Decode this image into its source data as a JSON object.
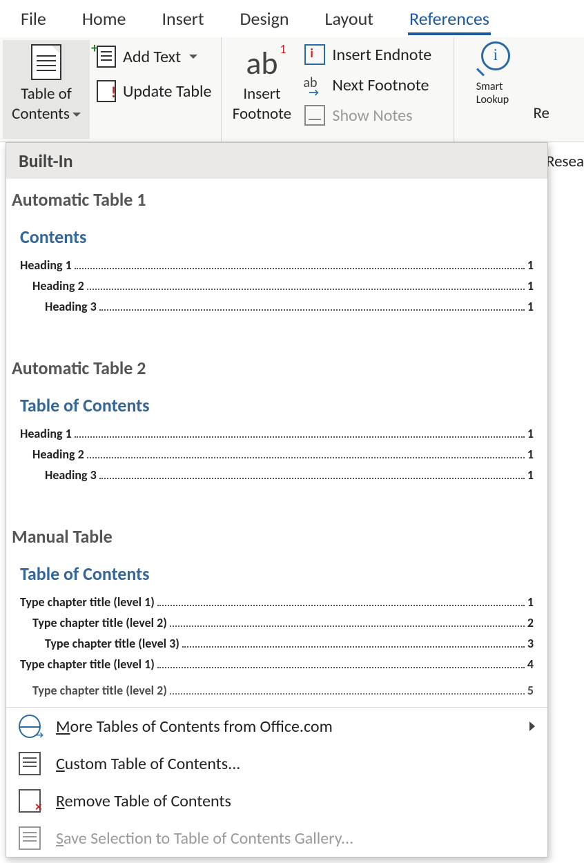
{
  "tabs": {
    "file": "File",
    "home": "Home",
    "insert": "Insert",
    "design": "Design",
    "layout": "Layout",
    "references": "References"
  },
  "ribbon": {
    "toc": {
      "line1": "Table of",
      "line2": "Contents"
    },
    "add_text": "Add Text",
    "update_table": "Update Table",
    "insert_footnote": {
      "line1": "Insert",
      "line2": "Footnote",
      "ab": "ab",
      "sup": "1"
    },
    "insert_endnote": "Insert Endnote",
    "next_footnote": "Next Footnote",
    "show_notes": "Show Notes",
    "smart_lookup": {
      "line1": "Smart",
      "line2": "Lookup"
    },
    "researcher_partial": "Re",
    "research_label_partial": "Resea"
  },
  "dropdown": {
    "built_in": "Built-In",
    "items": [
      {
        "title": "Automatic Table 1",
        "preview_title": "Contents",
        "rows": [
          {
            "label": "Heading 1",
            "pg": "1",
            "indent": 0
          },
          {
            "label": "Heading 2",
            "pg": "1",
            "indent": 1
          },
          {
            "label": "Heading 3",
            "pg": "1",
            "indent": 2
          }
        ]
      },
      {
        "title": "Automatic Table 2",
        "preview_title": "Table of Contents",
        "rows": [
          {
            "label": "Heading 1",
            "pg": "1",
            "indent": 0
          },
          {
            "label": "Heading 2",
            "pg": "1",
            "indent": 1
          },
          {
            "label": "Heading 3",
            "pg": "1",
            "indent": 2
          }
        ]
      },
      {
        "title": "Manual Table",
        "preview_title": "Table of Contents",
        "rows": [
          {
            "label": "Type chapter title (level 1)",
            "pg": "1",
            "indent": 0
          },
          {
            "label": "Type chapter title (level 2)",
            "pg": "2",
            "indent": 1
          },
          {
            "label": "Type chapter title (level 3)",
            "pg": "3",
            "indent": 2
          },
          {
            "label": "Type chapter title (level 1)",
            "pg": "4",
            "indent": 0
          },
          {
            "label": "Type chapter title (level 2)",
            "pg": "5",
            "indent": 1
          }
        ]
      }
    ],
    "menu": {
      "more": {
        "u": "M",
        "rest": "ore Tables of Contents from Office.com"
      },
      "custom": {
        "u": "C",
        "rest": "ustom Table of Contents..."
      },
      "remove": {
        "u": "R",
        "rest": "emove Table of Contents"
      },
      "save": {
        "u": "S",
        "rest": "ave Selection to Table of Contents Gallery..."
      }
    }
  }
}
